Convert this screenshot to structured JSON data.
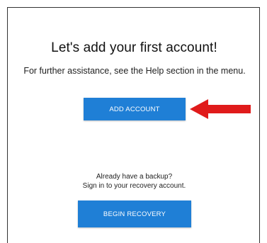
{
  "main": {
    "title": "Let's add your first account!",
    "help_text": "For further assistance, see the Help section in the menu.",
    "add_account_label": "ADD ACCOUNT",
    "backup_question": "Already have a backup?",
    "backup_instruction": "Sign in to your recovery account.",
    "begin_recovery_label": "BEGIN RECOVERY"
  },
  "colors": {
    "button": "#1f7fd6",
    "arrow": "#e01b1b"
  },
  "icons": {
    "pointer": "red-arrow-icon"
  }
}
